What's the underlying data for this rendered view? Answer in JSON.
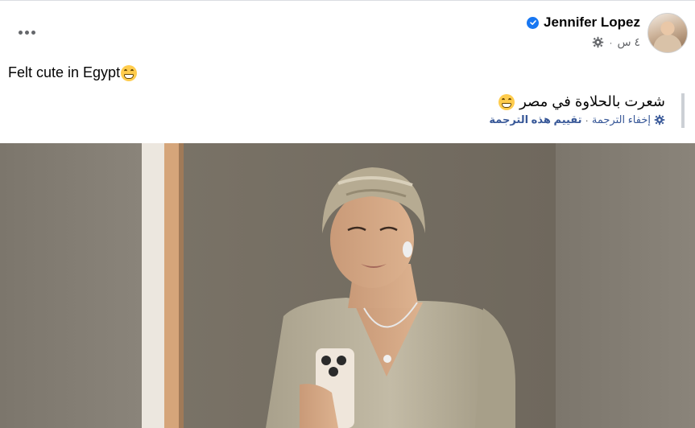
{
  "post": {
    "author": "Jennifer Lopez",
    "verified_icon": "verified-badge-icon",
    "time": "٤ س",
    "separator": "·",
    "audience_icon": "gear-icon",
    "text": "Felt cute in Egypt",
    "emoji": "grinning-face-emoji"
  },
  "translation": {
    "text": "شعرت بالحلاوة في مصر",
    "hide_label": "إخفاء الترجمة",
    "rate_label": "تقييم هذه الترجمة",
    "separator": "·",
    "settings_icon": "settings-icon"
  },
  "menu": {
    "more_icon": "more-options-icon"
  },
  "image": {
    "subject": "photo-post-image"
  }
}
